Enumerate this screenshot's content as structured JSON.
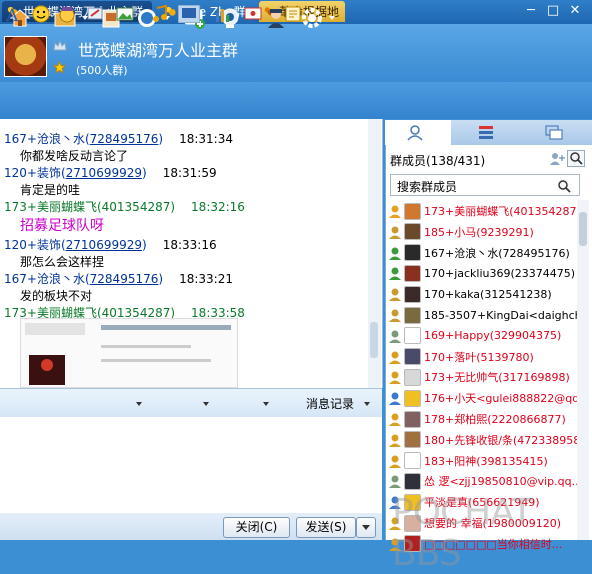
{
  "tabs": [
    {
      "label": "世茂蝶湖湾万人业主群"
    },
    {
      "label": "纯Ye Zhu群"
    },
    {
      "label": "革命根据地"
    }
  ],
  "window_controls": {
    "min": "─",
    "max": "□",
    "close": "✕"
  },
  "group": {
    "name": "世茂蝶湖湾万人业主群",
    "count": "(500人群)"
  },
  "toolbar_icons": [
    "home-icon",
    "folder-icon",
    "album-icon",
    "call-icon",
    "add-app-icon",
    "video-icon",
    "admin-icon",
    "settings-icon"
  ],
  "messages": [
    {
      "name": "167+沧浪丶水(",
      "num": "728495176",
      "close": ")",
      "time": "18:31:34",
      "text": "你都发啥反动言论了",
      "green": false
    },
    {
      "name": "120+装饰(",
      "num": "2710699929",
      "close": ")",
      "time": "18:31:59",
      "text": "肯定是的哇",
      "green": false
    },
    {
      "name": "173+美丽蝴蝶飞(401354287)",
      "num": "",
      "close": "",
      "time": "18:32:16",
      "text": "招募足球队呀",
      "green": true,
      "big": true
    },
    {
      "name": "120+装饰(",
      "num": "2710699929",
      "close": ")",
      "time": "18:33:16",
      "text": "那怎么会这样捏",
      "green": false
    },
    {
      "name": "167+沧浪丶水(",
      "num": "728495176",
      "close": ")",
      "time": "18:33:21",
      "text": "发的板块不对",
      "green": false
    },
    {
      "name": "173+美丽蝴蝶飞(401354287)",
      "num": "",
      "close": "",
      "time": "18:33:58",
      "text": "",
      "green": true
    }
  ],
  "input_toolbar": {
    "history_label": "消息记录"
  },
  "buttons": {
    "close": "关闭(C)",
    "send": "发送(S)"
  },
  "members_panel": {
    "title": "群成员(138/431)",
    "search_placeholder": "搜索群成员",
    "members": [
      {
        "name": "173+美丽蝴蝶飞(401354287)",
        "color": "#e0001a"
      },
      {
        "name": "185+小马(9239291)",
        "color": "#e0001a"
      },
      {
        "name": "167+沧浪丶水(728495176)",
        "color": "#000000"
      },
      {
        "name": "170+jackliu369(23374475)",
        "color": "#000000"
      },
      {
        "name": "170+kaka(312541238)",
        "color": "#000000"
      },
      {
        "name": "185-3507+KingDai<daighchp...",
        "color": "#000000"
      },
      {
        "name": "169+Happy(329904375)",
        "color": "#e0001a"
      },
      {
        "name": "170+落叶(5139780)",
        "color": "#e0001a"
      },
      {
        "name": "173+无比帅气(317169898)",
        "color": "#e0001a"
      },
      {
        "name": "176+小天<gulei888822@qq....",
        "color": "#e0001a"
      },
      {
        "name": "178+郑柏熙(2220866877)",
        "color": "#e0001a"
      },
      {
        "name": "180+先锋收银/条(472338958)",
        "color": "#e0001a"
      },
      {
        "name": "183+阳神(398135415)",
        "color": "#e0001a"
      },
      {
        "name": "怂 逻<zjj19850810@vip.qq....",
        "color": "#e0001a"
      },
      {
        "name": "平淡是真(656621949)",
        "color": "#e0001a"
      },
      {
        "name": "想要的 幸福(1980009120)",
        "color": "#e0001a"
      },
      {
        "name": "□□□□□□□当你相信时...",
        "color": "#e0001a"
      }
    ]
  },
  "watermark": "POCHAT BBS",
  "colors": {
    "accent": "#3a8bd3",
    "member_red": "#e0001a",
    "msg_name": "#003399",
    "msg_green": "#0a7a2a"
  }
}
